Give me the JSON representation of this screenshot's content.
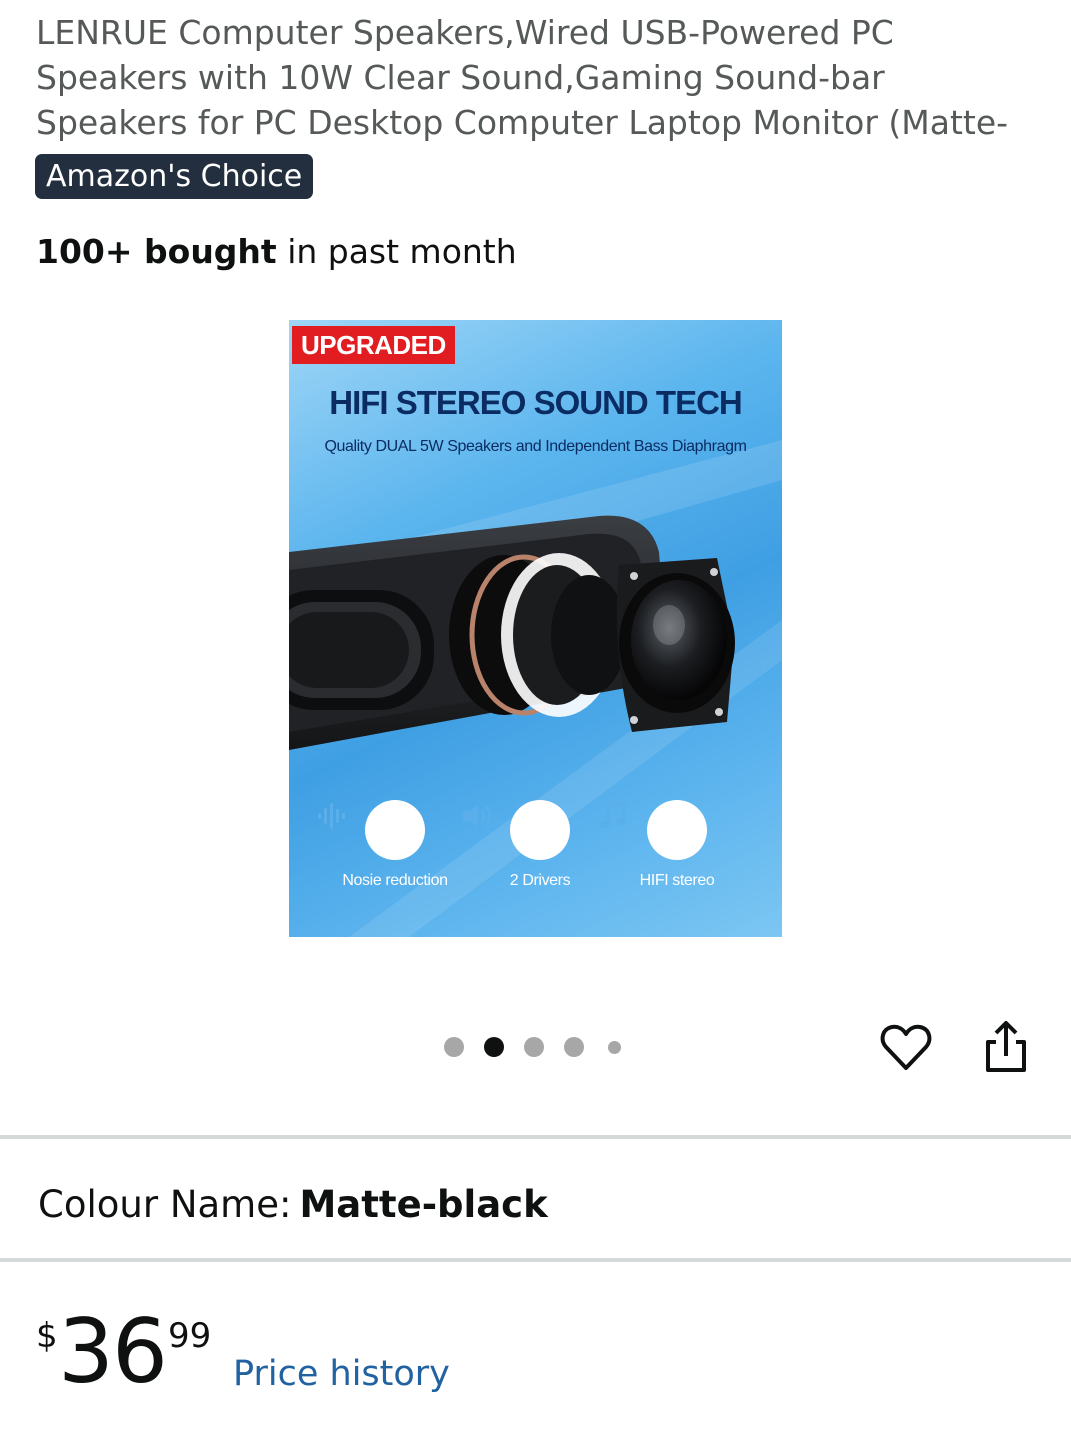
{
  "product": {
    "title": "LENRUE Computer Speakers,Wired USB-Powered PC Speakers with 10W Clear Sound,Gaming Sound-bar Speakers for PC Desktop Computer Laptop Monitor (Matte-Black)",
    "badge": "Amazon's Choice",
    "bought_count": "100+ bought",
    "bought_suffix": " in past month"
  },
  "image": {
    "tag": "UPGRADED",
    "headline": "HIFI STEREO SOUND TECH",
    "subline": "Quality DUAL 5W Speakers and Independent Bass Diaphragm",
    "features": [
      {
        "label": "Nosie reduction",
        "icon": "waveform-icon"
      },
      {
        "label": "2 Drivers",
        "icon": "speaker-volume-icon"
      },
      {
        "label": "HIFI stereo",
        "icon": "music-note-icon"
      }
    ]
  },
  "carousel": {
    "total": 5,
    "active_index": 1
  },
  "actions": {
    "wishlist_icon": "heart-icon",
    "share_icon": "share-icon"
  },
  "variation": {
    "label": "Colour Name:",
    "value": "Matte-black"
  },
  "price": {
    "symbol": "$",
    "whole": "36",
    "fraction": "99",
    "history_link": "Price history"
  },
  "colors": {
    "link": "#2162a1",
    "badge_bg": "#232f3e",
    "tag_red": "#e11d22",
    "divider": "#d5d9d9"
  }
}
